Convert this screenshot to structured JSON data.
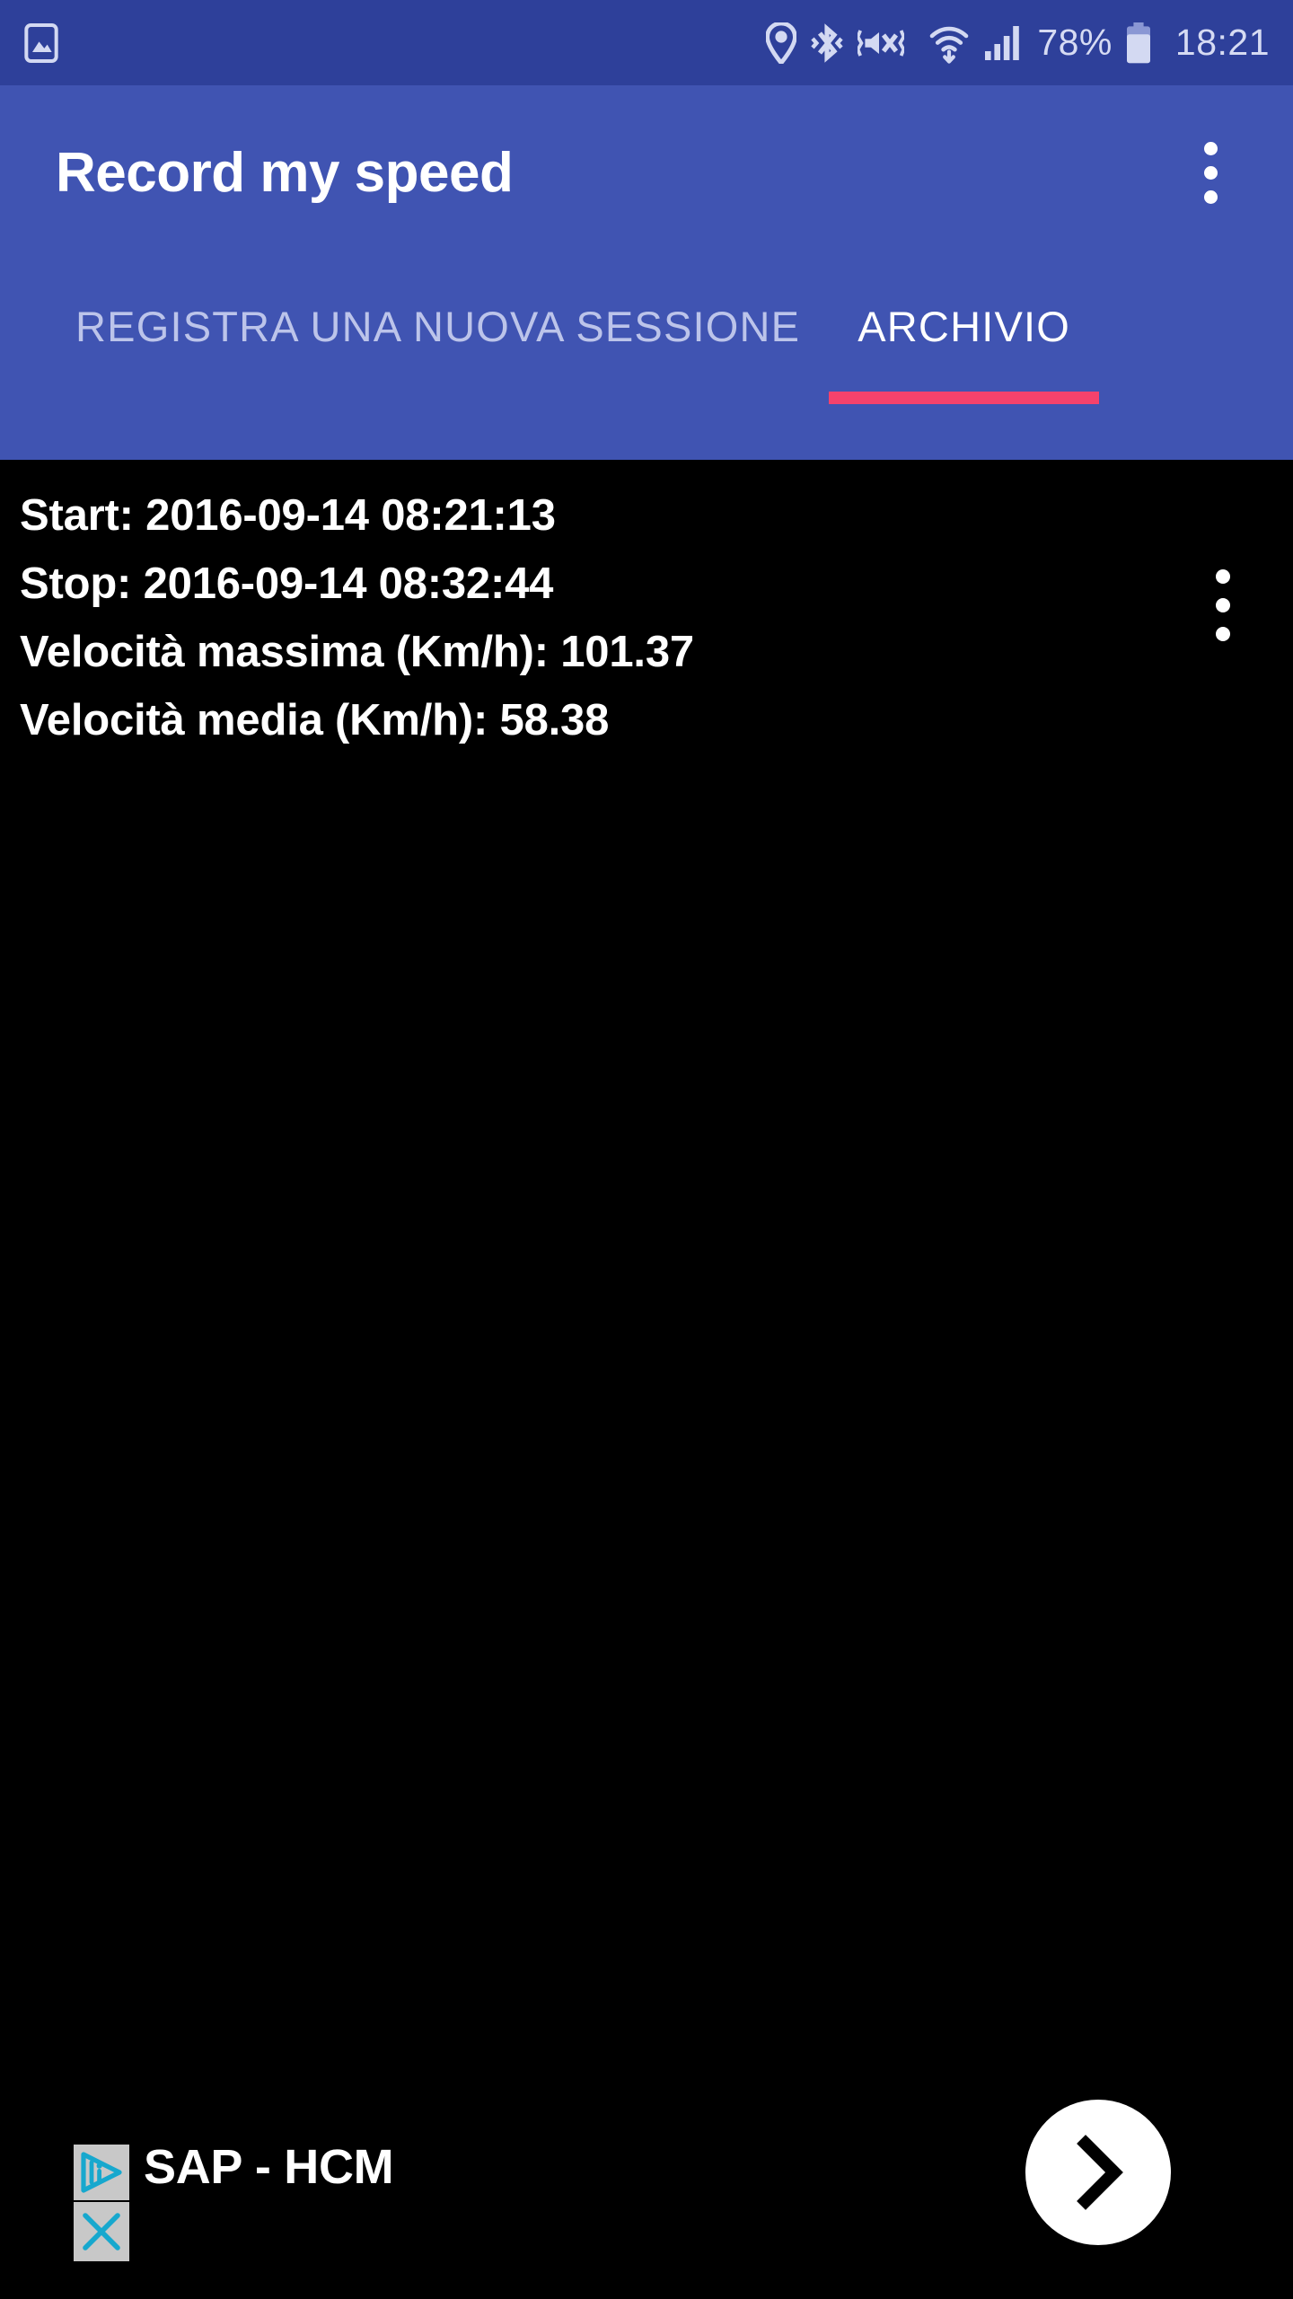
{
  "status_bar": {
    "left_icons": [
      {
        "name": "screenshot-image-icon",
        "label": "image"
      }
    ],
    "right_icons": [
      {
        "name": "location-pin-icon",
        "label": "location"
      },
      {
        "name": "bluetooth-icon",
        "label": "bluetooth"
      },
      {
        "name": "mute-vibrate-icon",
        "label": "sound off"
      },
      {
        "name": "wifi-icon",
        "label": "wi-fi"
      },
      {
        "name": "cellular-signal-icon",
        "label": "signal"
      }
    ],
    "battery_percent": "78%",
    "battery_icon": "battery-icon",
    "clock": "18:21"
  },
  "app_bar": {
    "title": "Record my speed",
    "overflow_menu": "overflow-menu",
    "background_color": "#4054B2"
  },
  "tabs": {
    "items": [
      {
        "label": "REGISTRA UNA NUOVA SESSIONE",
        "active": false
      },
      {
        "label": "ARCHIVIO",
        "active": true
      }
    ],
    "indicator_color": "#F5426C"
  },
  "archive": {
    "sessions": [
      {
        "start": "Start: 2016-09-14 08:21:13",
        "stop": "Stop: 2016-09-14 08:32:44",
        "max_speed": "Velocità massima (Km/h): 101.37",
        "avg_speed": "Velocità media (Km/h): 58.38"
      }
    ]
  },
  "ad": {
    "title": "SAP - HCM",
    "adchoices_icon": "adchoices-icon",
    "close_icon": "close-icon",
    "next_icon": "chevron-right-icon"
  }
}
